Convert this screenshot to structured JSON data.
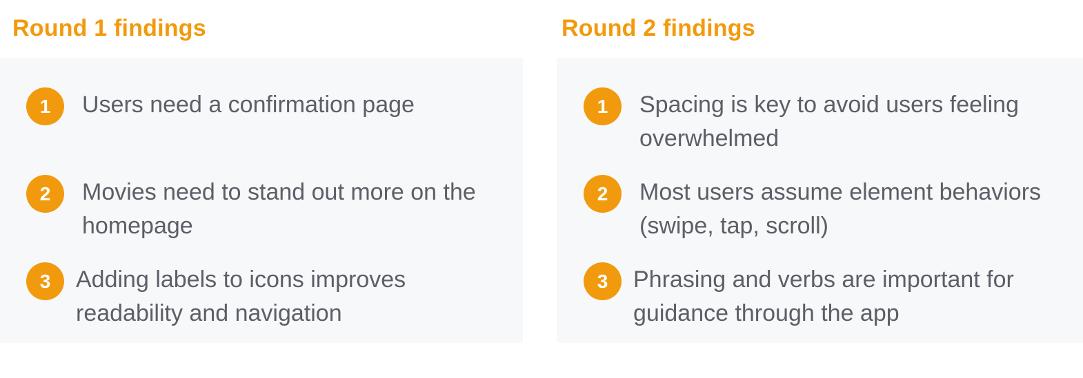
{
  "round1": {
    "title": "Round 1 findings",
    "items": [
      {
        "number": "1",
        "text": "Users need a confirmation page"
      },
      {
        "number": "2",
        "text": "Movies need to stand out more on the homepage"
      },
      {
        "number": "3",
        "text": "Adding labels to icons improves readability and navigation"
      }
    ]
  },
  "round2": {
    "title": "Round 2 findings",
    "items": [
      {
        "number": "1",
        "text": "Spacing is key to avoid users feeling overwhelmed"
      },
      {
        "number": "2",
        "text": "Most users assume element behaviors (swipe, tap, scroll)"
      },
      {
        "number": "3",
        "text": "Phrasing and verbs are important for guidance through the app"
      }
    ]
  },
  "colors": {
    "accent": "#f29a0d",
    "panel_background": "#f7f8fa",
    "body_text": "#5b5f66"
  }
}
